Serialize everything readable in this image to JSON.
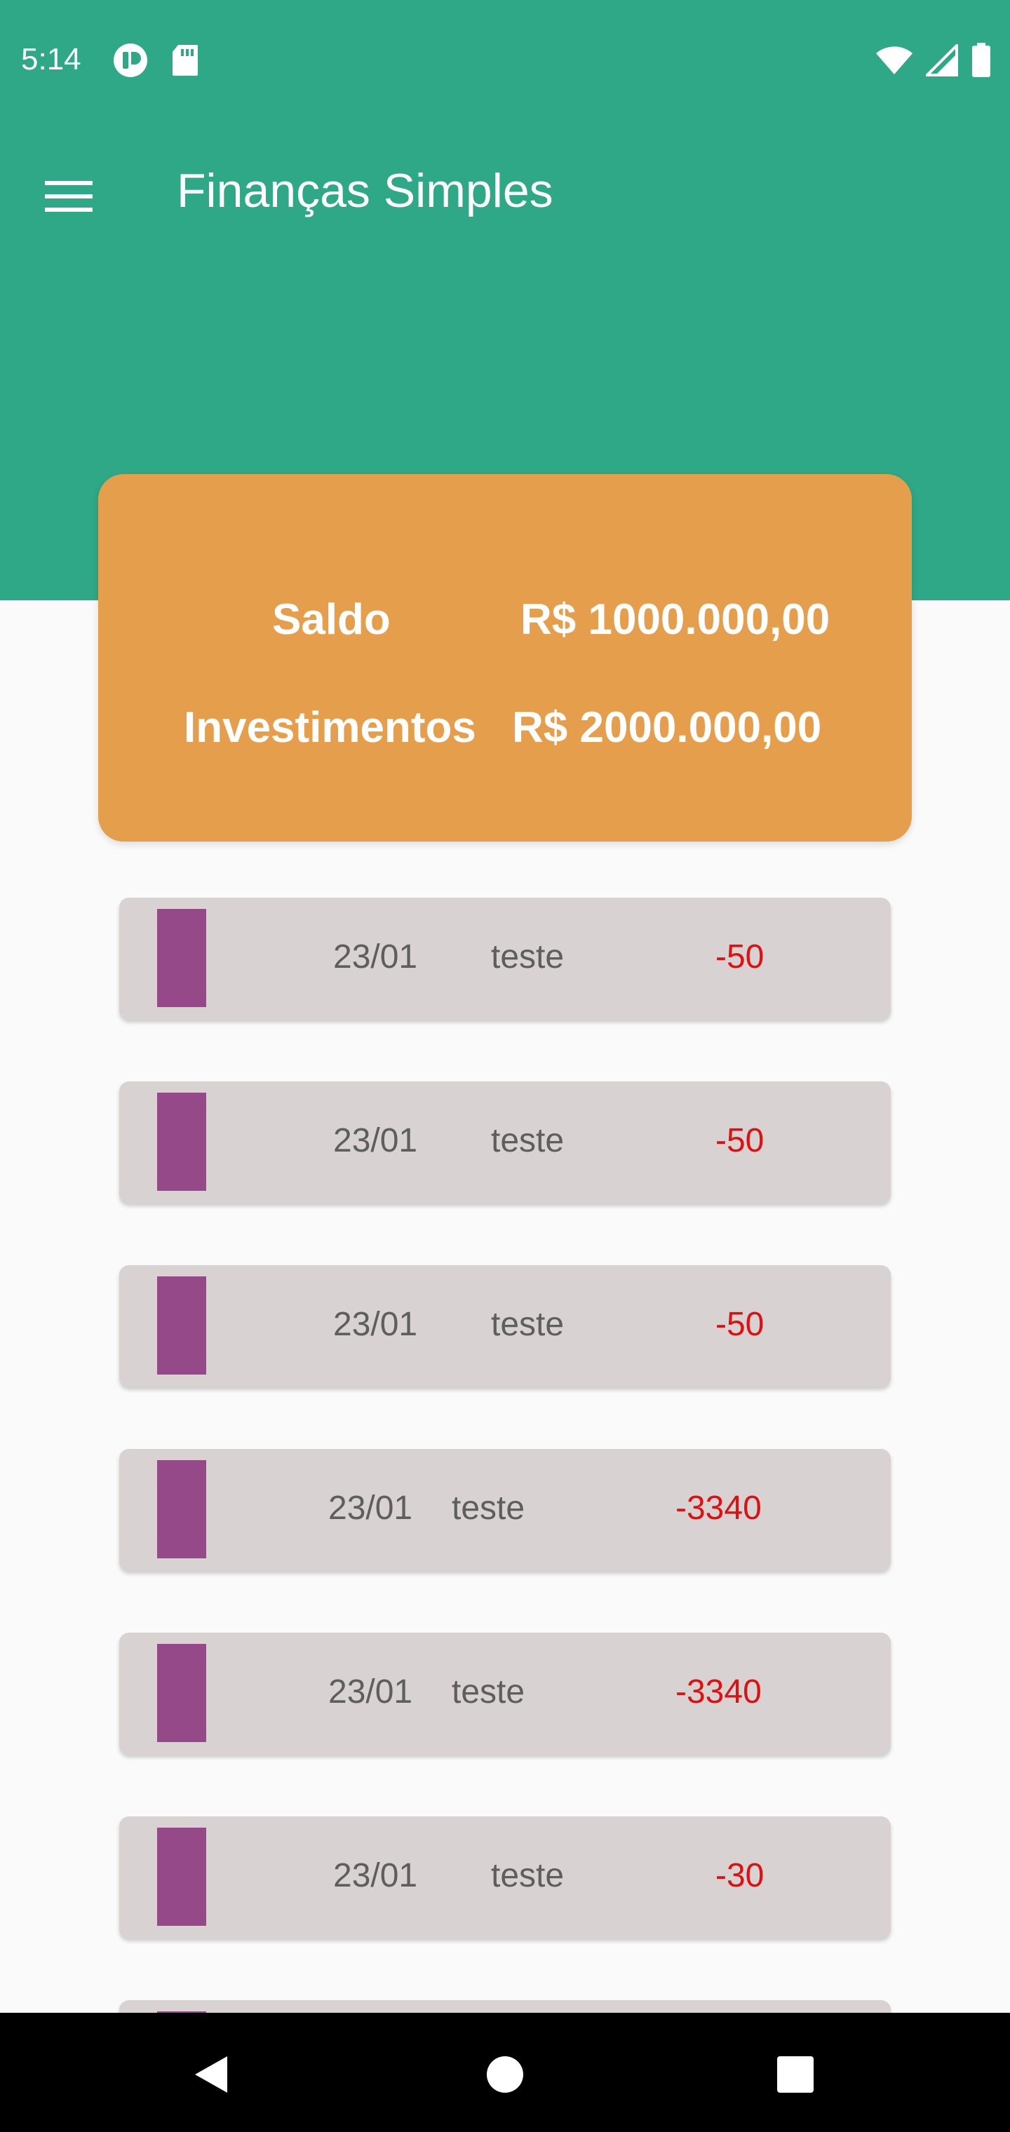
{
  "status_bar": {
    "time": "5:14"
  },
  "app_bar": {
    "title": "Finanças Simples",
    "menu_icon": "hamburger-menu-icon"
  },
  "summary": {
    "balance_label": "Saldo",
    "balance_value": "R$ 1000.000,00",
    "investments_label": "Investimentos",
    "investments_value": "R$ 2000.000,00"
  },
  "transactions": [
    {
      "date": "23/01",
      "description": "teste",
      "amount": "-50"
    },
    {
      "date": "23/01",
      "description": "teste",
      "amount": "-50"
    },
    {
      "date": "23/01",
      "description": "teste",
      "amount": "-50"
    },
    {
      "date": "23/01",
      "description": "teste",
      "amount": "-3340"
    },
    {
      "date": "23/01",
      "description": "teste",
      "amount": "-3340"
    },
    {
      "date": "23/01",
      "description": "teste",
      "amount": "-30"
    }
  ],
  "colors": {
    "header": "#2ea886",
    "card": "#e59e4c",
    "marker": "#964989",
    "negative_amount": "#e01010"
  }
}
